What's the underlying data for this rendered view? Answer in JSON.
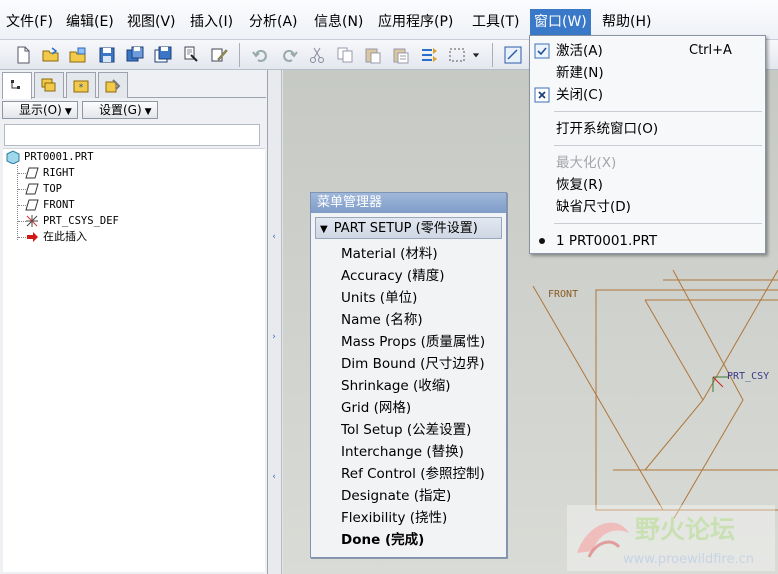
{
  "menubar": {
    "items": [
      {
        "label": "文件(F)"
      },
      {
        "label": "编辑(E)"
      },
      {
        "label": "视图(V)"
      },
      {
        "label": "插入(I)"
      },
      {
        "label": "分析(A)"
      },
      {
        "label": "信息(N)"
      },
      {
        "label": "应用程序(P)"
      },
      {
        "label": "工具(T)"
      },
      {
        "label": "窗口(W)"
      },
      {
        "label": "帮助(H)"
      }
    ],
    "active": "窗口(W)"
  },
  "toolbar": {
    "icons": [
      "new-file-icon",
      "open-folder-icon",
      "open-from-session-icon",
      "save-icon",
      "save-copy-icon",
      "backup-icon",
      "print-icon",
      "drafting-icon",
      "undo-icon",
      "redo-icon",
      "cut-icon",
      "copy-icon",
      "paste-icon",
      "paste-special-icon",
      "regenerate-icon",
      "select-box-icon",
      "dropdown-arrow-icon",
      "sketch-view-icon"
    ]
  },
  "left_panel": {
    "tabs": [
      "model-tree-icon",
      "layers-icon",
      "favorites-icon",
      "connections-icon"
    ],
    "show_button": "显示(O)",
    "settings_button": "设置(G)",
    "tree": [
      {
        "label": "PRT0001.PRT",
        "icon": "part-icon"
      },
      {
        "label": "RIGHT",
        "icon": "datum-plane-icon"
      },
      {
        "label": "TOP",
        "icon": "datum-plane-icon"
      },
      {
        "label": "FRONT",
        "icon": "datum-plane-icon"
      },
      {
        "label": "PRT_CSYS_DEF",
        "icon": "csys-icon"
      },
      {
        "label": "在此插入",
        "icon": "insert-here-arrow-icon"
      }
    ]
  },
  "menu_manager": {
    "title": "菜单管理器",
    "header": "PART SETUP (零件设置)",
    "items": [
      "Material (材料)",
      "Accuracy (精度)",
      "Units (单位)",
      "Name (名称)",
      "Mass Props (质量属性)",
      "Dim Bound (尺寸边界)",
      "Shrinkage (收缩)",
      "Grid (网格)",
      "Tol Setup (公差设置)",
      "Interchange (替换)",
      "Ref Control (参照控制)",
      "Designate (指定)",
      "Flexibility (挠性)",
      "Done (完成)"
    ]
  },
  "window_menu": {
    "activate": {
      "label": "激活(A)",
      "shortcut": "Ctrl+A"
    },
    "new": {
      "label": "新建(N)"
    },
    "close": {
      "label": "关闭(C)"
    },
    "open_system_window": {
      "label": "打开系统窗口(O)"
    },
    "maximize": {
      "label": "最大化(X)"
    },
    "restore": {
      "label": "恢复(R)"
    },
    "default_size": {
      "label": "缺省尺寸(D)"
    },
    "window_list": {
      "label": "1 PRT0001.PRT"
    }
  },
  "graphics": {
    "front_label": "FRONT",
    "csys_label": "PRT_CSY",
    "accent_color": "#b0763a"
  },
  "watermark": {
    "title": "野火论坛",
    "url": "www.proewildfire.cn"
  }
}
